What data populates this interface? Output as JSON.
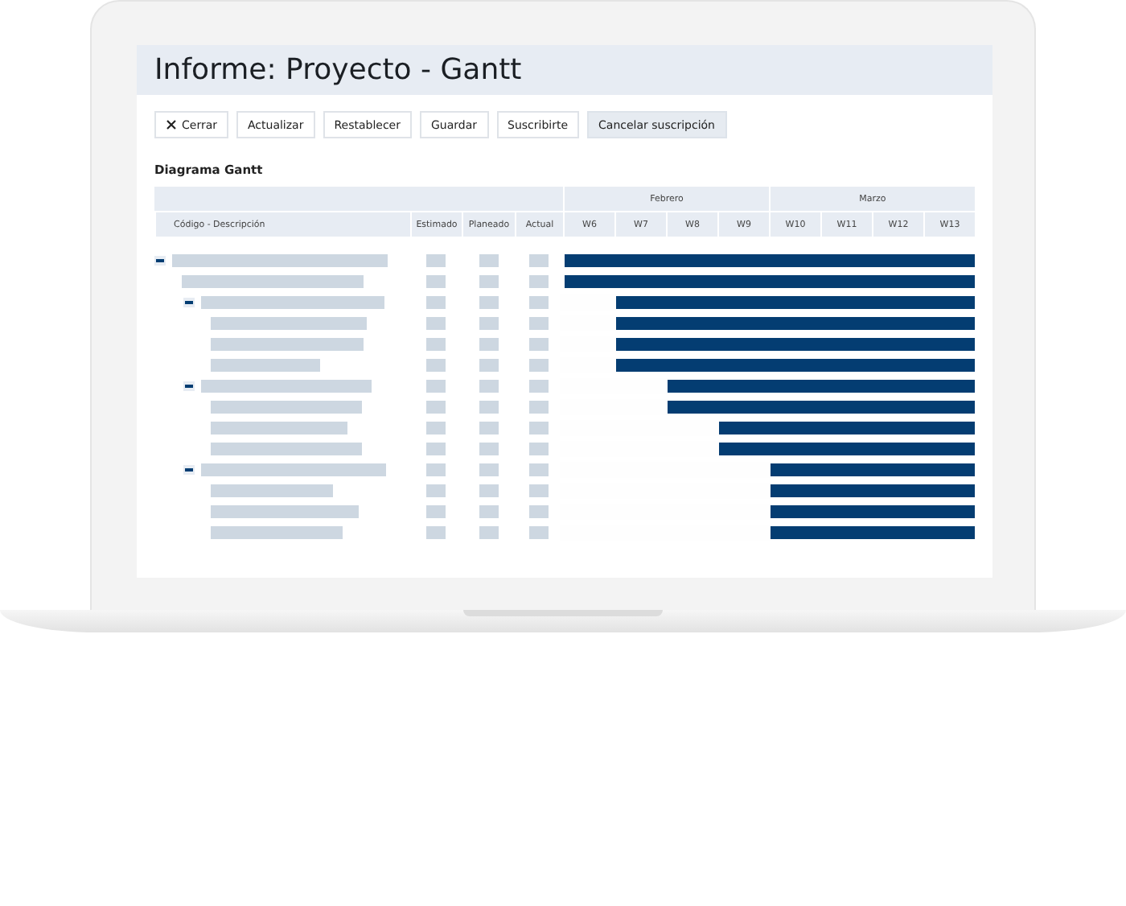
{
  "title": "Informe: Proyecto - Gantt",
  "toolbar": [
    {
      "label": "Cerrar",
      "kind": "close",
      "selected": false
    },
    {
      "label": "Actualizar",
      "kind": "plain",
      "selected": false
    },
    {
      "label": "Restablecer",
      "kind": "plain",
      "selected": false
    },
    {
      "label": "Guardar",
      "kind": "plain",
      "selected": false
    },
    {
      "label": "Suscribirte",
      "kind": "plain",
      "selected": false
    },
    {
      "label": "Cancelar suscripción",
      "kind": "plain",
      "selected": true
    }
  ],
  "section_title": "Diagrama Gantt",
  "columns": [
    "Código - Descripción",
    "Estimado",
    "Planeado",
    "Actual"
  ],
  "months": [
    {
      "label": "Febrero",
      "weeks": [
        "W6",
        "W7",
        "W8",
        "W9"
      ]
    },
    {
      "label": "Marzo",
      "weeks": [
        "W10",
        "W11",
        "W12",
        "W13"
      ]
    }
  ],
  "rows": [
    {
      "expanded": true,
      "level": 1,
      "children": [
        {
          "level": 1
        },
        {
          "expanded": true,
          "level": 0.875,
          "children": [
            {
              "level": 0.875
            },
            {
              "level": 0.875
            },
            {
              "level": 0.875
            }
          ]
        },
        {
          "expanded": true,
          "level": 0.75,
          "children": [
            {
              "level": 0.75
            },
            {
              "level": 0.625
            },
            {
              "level": 0.625
            }
          ]
        },
        {
          "expanded": true,
          "level": 0.5,
          "children": [
            {
              "level": 0.5
            },
            {
              "level": 0.5
            },
            {
              "level": 0.5
            }
          ]
        }
      ]
    }
  ]
}
